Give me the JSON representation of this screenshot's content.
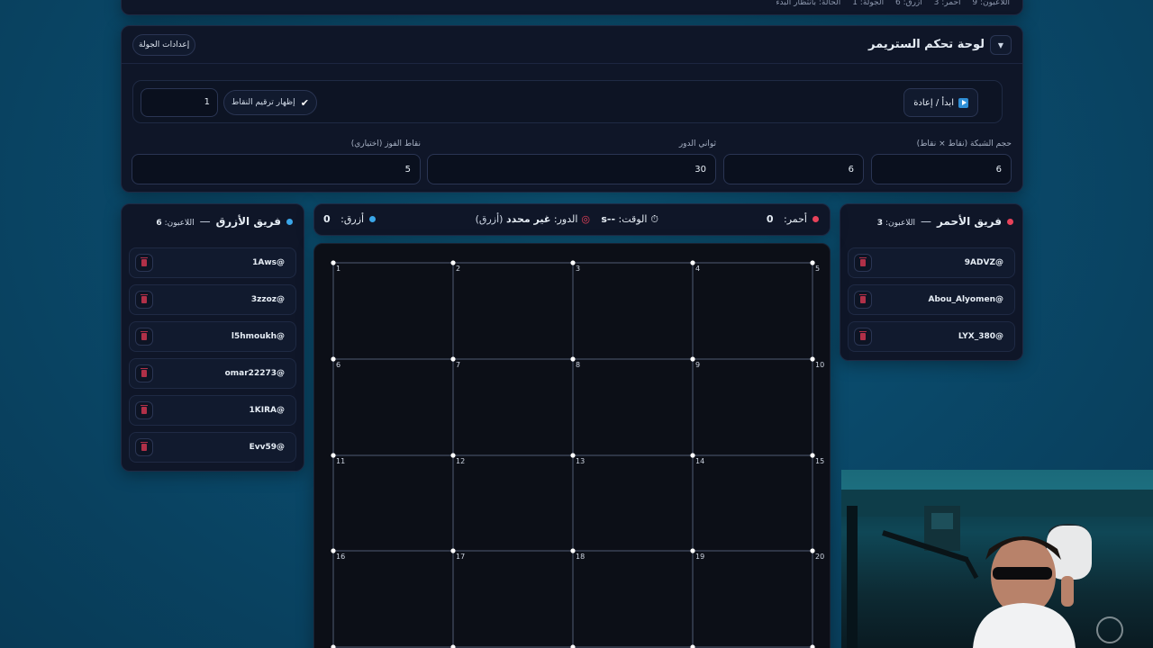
{
  "top_strip": {
    "crumbs": [
      "اللاعبون: 9",
      "أحمر: 3",
      "أزرق: 6",
      "الجولة: 1",
      "الحالة: بانتظار البدء"
    ]
  },
  "control_panel": {
    "title": "لوحة تحكم الستريمر",
    "round_settings_label": "إعدادات الجولة",
    "start_label": "ابدأ / إعادة",
    "show_numbering_label": "إظهار ترقيم النقاط",
    "numbering_value": "1",
    "fields": [
      {
        "label": "حجم الشبكة (نقاط × نقاط)",
        "value": "6"
      },
      {
        "label": "",
        "value": "6"
      },
      {
        "label": "ثواني الدور",
        "value": "30"
      },
      {
        "label": "نقاط الفوز (اختياري)",
        "value": "5"
      }
    ]
  },
  "red_team": {
    "name": "فريق الأحمر",
    "players_label": "اللاعبون:",
    "players_count": "3",
    "color": "#e8425a",
    "players": [
      "9ADVZ@",
      "Abou_Alyomen@",
      "LYX_380@"
    ]
  },
  "blue_team": {
    "name": "فريق الأزرق",
    "players_label": "اللاعبون:",
    "players_count": "6",
    "color": "#3aa6e8",
    "players": [
      "1Aws@",
      "3zzoz@",
      "l5hmoukh@",
      "omar22273@",
      "1KIRA@",
      "Evv59@"
    ]
  },
  "status": {
    "red_label": "أحمر:",
    "red_score": "0",
    "time_label": "الوقت:",
    "time_value": "--s",
    "turn_label": "الدور:",
    "turn_value": "غير محدد",
    "turn_team": "(أزرق)",
    "blue_label": "أزرق:",
    "blue_score": "0"
  },
  "board": {
    "dot_numbers": [
      "1",
      "2",
      "3",
      "4",
      "5",
      "6",
      "7",
      "8",
      "9",
      "10",
      "11",
      "12",
      "13",
      "14",
      "15",
      "16",
      "17",
      "18",
      "19",
      "20"
    ]
  }
}
